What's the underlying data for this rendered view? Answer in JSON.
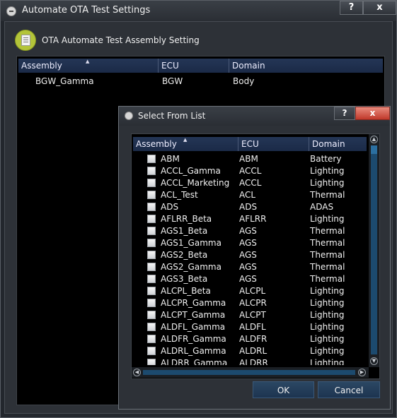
{
  "main_window": {
    "title": "Automate OTA Test Settings",
    "help_label": "?",
    "close_label": "x",
    "section_title": "OTA Automate Test Assembly Setting",
    "columns": [
      "Assembly",
      "ECU",
      "Domain"
    ],
    "rows": [
      {
        "assembly": "BGW_Gamma",
        "ecu": "BGW",
        "domain": "Body"
      }
    ]
  },
  "dialog": {
    "title": "Select From List",
    "help_label": "?",
    "close_label": "x",
    "columns": [
      "Assembly",
      "ECU",
      "Domain"
    ],
    "rows": [
      {
        "assembly": "ABM",
        "ecu": "ABM",
        "domain": "Battery",
        "checked": false
      },
      {
        "assembly": "ACCL_Gamma",
        "ecu": "ACCL",
        "domain": "Lighting",
        "checked": false
      },
      {
        "assembly": "ACCL_Marketing",
        "ecu": "ACCL",
        "domain": "Lighting",
        "checked": false
      },
      {
        "assembly": "ACL_Test",
        "ecu": "ACL",
        "domain": "Thermal",
        "checked": false
      },
      {
        "assembly": "ADS",
        "ecu": "ADS",
        "domain": "ADAS",
        "checked": false
      },
      {
        "assembly": "AFLRR_Beta",
        "ecu": "AFLRR",
        "domain": "Lighting",
        "checked": false
      },
      {
        "assembly": "AGS1_Beta",
        "ecu": "AGS",
        "domain": "Thermal",
        "checked": false
      },
      {
        "assembly": "AGS1_Gamma",
        "ecu": "AGS",
        "domain": "Thermal",
        "checked": false
      },
      {
        "assembly": "AGS2_Beta",
        "ecu": "AGS",
        "domain": "Thermal",
        "checked": false
      },
      {
        "assembly": "AGS2_Gamma",
        "ecu": "AGS",
        "domain": "Thermal",
        "checked": false
      },
      {
        "assembly": "AGS3_Beta",
        "ecu": "AGS",
        "domain": "Thermal",
        "checked": false
      },
      {
        "assembly": "ALCPL_Beta",
        "ecu": "ALCPL",
        "domain": "Lighting",
        "checked": false
      },
      {
        "assembly": "ALCPR_Gamma",
        "ecu": "ALCPR",
        "domain": "Lighting",
        "checked": false
      },
      {
        "assembly": "ALCPT_Gamma",
        "ecu": "ALCPT",
        "domain": "Lighting",
        "checked": false
      },
      {
        "assembly": "ALDFL_Gamma",
        "ecu": "ALDFL",
        "domain": "Lighting",
        "checked": false
      },
      {
        "assembly": "ALDFR_Gamma",
        "ecu": "ALDFR",
        "domain": "Lighting",
        "checked": false
      },
      {
        "assembly": "ALDRL_Gamma",
        "ecu": "ALDRL",
        "domain": "Lighting",
        "checked": false
      },
      {
        "assembly": "ALDRR_Gamma",
        "ecu": "ALDRR",
        "domain": "Lighting",
        "checked": false
      }
    ],
    "ok_label": "OK",
    "cancel_label": "Cancel"
  },
  "icons": {
    "app": "app-icon",
    "header": "document-list-icon",
    "sort": "sort-ascending-icon",
    "scroll_up": "scroll-up-icon",
    "scroll_down": "scroll-down-icon",
    "scroll_left": "scroll-left-icon",
    "scroll_right": "scroll-right-icon"
  },
  "colors": {
    "header_bg": "#1b2a47",
    "button_bg": "#1d3450",
    "close_red": "#c0392b",
    "scroll_thumb": "#1c4a6e",
    "accent_green": "#b3c43a"
  }
}
